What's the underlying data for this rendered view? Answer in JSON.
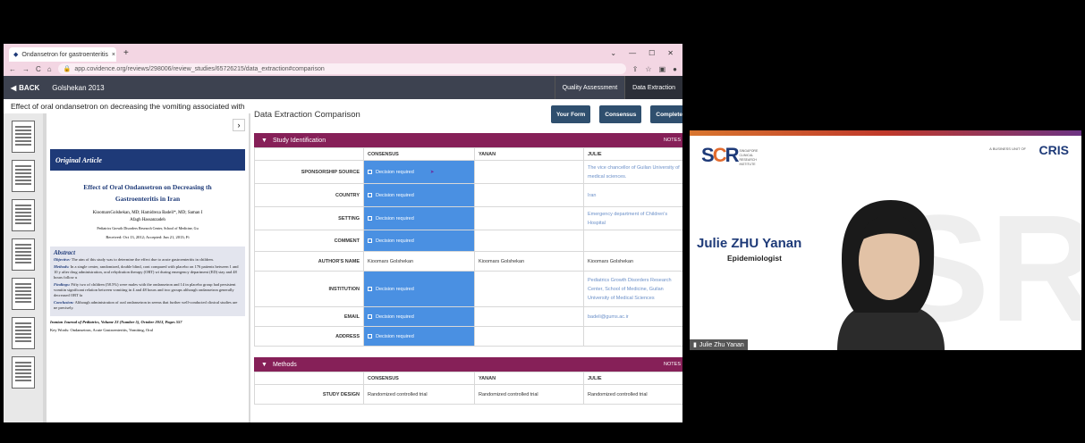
{
  "browser": {
    "tab_title": "Ondansetron for gastroenteritis",
    "tab_close": "×",
    "new_tab": "+",
    "window_controls": [
      "⌄",
      "—",
      "☐",
      "✕"
    ],
    "url": "app.covidence.org/reviews/298006/review_studies/65726215/data_extraction#comparison",
    "nav_back": "←",
    "nav_forward": "→",
    "reload": "C",
    "home": "⌂"
  },
  "app": {
    "back_label": "BACK",
    "study_title": "Golshekan 2013",
    "nav_tabs": [
      {
        "label": "Quality Assessment"
      },
      {
        "label": "Data Extraction"
      }
    ],
    "document_title": "Effect of oral ondansetron on decreasing the vomiting associated with a"
  },
  "pdf": {
    "original_article": "Original Article",
    "article_title_1": "Effect of Oral Ondansetron on Decreasing th",
    "article_title_2": "Gastroenteritis in Iran",
    "authors_1": "KioomarsGolshekan, MD; Hamidreza Badeli*, MD; Saman I",
    "authors_2": "Afagh Hassanzadeh",
    "affiliation": "Pediatrics Growth Disorders Research Center, School of Medicine, Gu",
    "received": "Received: Oct 13, 2012; Accepted: Jun 21, 2013; Fi",
    "abstract_heading": "Abstract",
    "abstract_paras": [
      {
        "lead": "Objective:",
        "text": " The aim of this study was to determine the effect due to acute gastroenteritis in children."
      },
      {
        "lead": "Methods:",
        "text": " In a single center, randomized, double blind, cont compared with placebo on 176 patients between 1 and 10 y after drug administration, oral rehydration therapy (ORT) wi during emergency department (ED) stay and 48 hours follow u"
      },
      {
        "lead": "Findings:",
        "text": " Fifty two of children (58.5%) were males with the ondansetron and 14 in placebo group had persistent vomitin significant relation between vomiting in 4 and 48 hours and two groups although ondansetron generally decreased ORT fa"
      },
      {
        "lead": "Conclusion:",
        "text": " Although administration of oral ondansetron in seems that further well-conducted clinical studies are ne precisely."
      }
    ],
    "journal": "Iranian Journal of Pediatrics, Volume 23 (Number 5), October 2013, Pages 557",
    "keywords": "Key Words: Ondansetron, Acute Gastroenteritis, Vomiting, Oral"
  },
  "comparison": {
    "title": "Data Extraction Comparison",
    "buttons": [
      "Your Form",
      "Consensus",
      "Complete"
    ],
    "sections": [
      {
        "name": "Study Identification",
        "notes": "NOTES",
        "columns": [
          "CONSENSUS",
          "YANAN",
          "JULIE"
        ],
        "rows": [
          {
            "label": "SPONSORSHIP SOURCE",
            "consensus": "Decision required",
            "yanan": "",
            "julie": "The vice chancellor of Guilan University of medical sciences."
          },
          {
            "label": "COUNTRY",
            "consensus": "Decision required",
            "yanan": "",
            "julie": "Iran"
          },
          {
            "label": "SETTING",
            "consensus": "Decision required",
            "yanan": "",
            "julie": "Emergency department of Children's Hospital"
          },
          {
            "label": "COMMENT",
            "consensus": "Decision required",
            "yanan": "",
            "julie": ""
          },
          {
            "label": "AUTHOR'S NAME",
            "consensus": "Kioomars Golshekan",
            "yanan": "Kioomars Golshekan",
            "julie": "Kioomars Golshekan"
          },
          {
            "label": "INSTITUTION",
            "consensus": "Decision required",
            "yanan": "",
            "julie": "Pediatrics Growth Disorders Research Center, School of Medicine, Guilan University of Medical Sciences"
          },
          {
            "label": "EMAIL",
            "consensus": "Decision required",
            "yanan": "",
            "julie": "badeli@gums.ac.ir"
          },
          {
            "label": "ADDRESS",
            "consensus": "Decision required",
            "yanan": "",
            "julie": ""
          }
        ]
      },
      {
        "name": "Methods",
        "notes": "NOTES",
        "columns": [
          "CONSENSUS",
          "YANAN",
          "JULIE"
        ],
        "rows": [
          {
            "label": "STUDY DESIGN",
            "consensus": "Randomized controlled trial",
            "yanan": "Randomized controlled trial",
            "julie": "Randomized controlled trial"
          }
        ]
      }
    ]
  },
  "video": {
    "logo_lines": [
      "SINGAPORE",
      "CLINICAL",
      "RESEARCH",
      "INSTITUTE"
    ],
    "partner_small": "A BUSINESS UNIT OF",
    "partner": "CRIS",
    "speaker_name": "Julie ZHU Yanan",
    "speaker_role": "Epidemiologist",
    "participant_label": "Julie Zhu Yanan"
  },
  "colors": {
    "section_bar": "#862058",
    "decision_cell": "#4a90e2",
    "button": "#2f4f6e",
    "brand_blue": "#1e3a78"
  }
}
